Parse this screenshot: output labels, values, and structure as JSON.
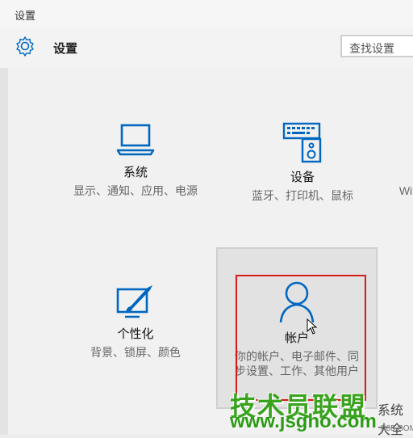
{
  "window": {
    "title": "设置"
  },
  "header": {
    "title": "设置",
    "search_placeholder": "查找设置"
  },
  "tiles": [
    {
      "label": "系统",
      "desc": "显示、通知、应用、电源"
    },
    {
      "label": "设备",
      "desc": "蓝牙、打印机、鼠标"
    },
    {
      "partial_label": "Wi"
    },
    {
      "label": "个性化",
      "desc": "背景、锁屏、颜色"
    },
    {
      "label": "帐户",
      "desc": "你的帐户、电子邮件、同步设置、工作、其他用户"
    }
  ],
  "watermark": {
    "brand": "技术员联盟",
    "url": "www.jsgho.com",
    "side_text": "系统大全",
    "small_text": "P85.COM"
  },
  "colors": {
    "accent": "#0067c0",
    "highlight_border": "#d61b1b",
    "watermark_green": "#39a31e"
  },
  "icons": [
    "gear-icon",
    "laptop-icon",
    "keyboard-speaker-icon",
    "paintbrush-monitor-icon",
    "person-icon",
    "cursor-icon"
  ]
}
